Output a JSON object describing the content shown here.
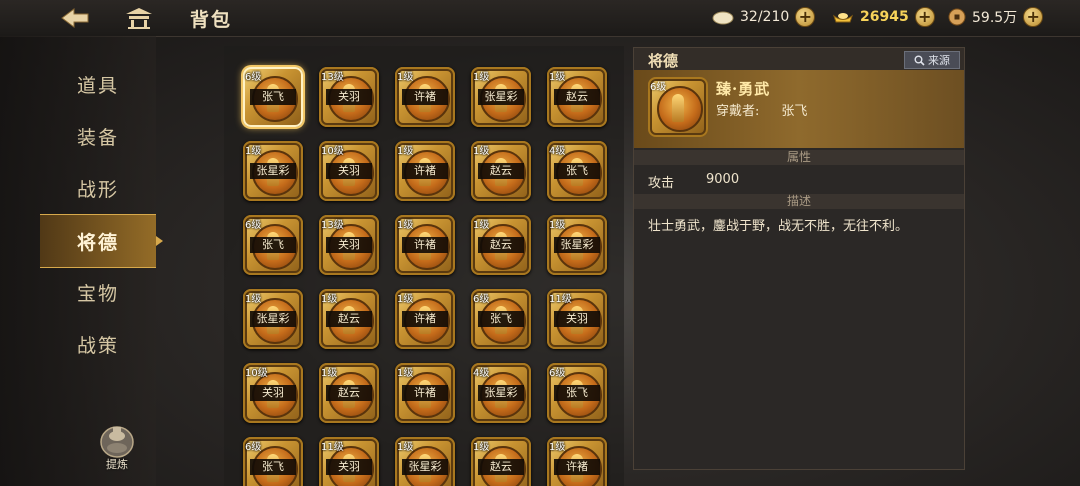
{
  "header": {
    "title": "背包",
    "back_icon": "back-arrow-icon",
    "home_icon": "pavilion-icon"
  },
  "resources": [
    {
      "icon": "rice-icon",
      "value": "32/210"
    },
    {
      "icon": "gold-ingot-icon",
      "value": "26945"
    },
    {
      "icon": "copper-coin-icon",
      "value": "59.5万"
    }
  ],
  "sidebar": {
    "items": [
      {
        "label": "道具",
        "active": false
      },
      {
        "label": "装备",
        "active": false
      },
      {
        "label": "战形",
        "active": false
      },
      {
        "label": "将德",
        "active": true
      },
      {
        "label": "宝物",
        "active": false
      },
      {
        "label": "战策",
        "active": false
      }
    ],
    "refine_label": "提炼"
  },
  "grid": {
    "items": [
      {
        "level": "6级",
        "name": "张飞",
        "selected": true
      },
      {
        "level": "13级",
        "name": "关羽"
      },
      {
        "level": "1级",
        "name": "许褚"
      },
      {
        "level": "1级",
        "name": "张星彩"
      },
      {
        "level": "1级",
        "name": "赵云"
      },
      {
        "level": "1级",
        "name": "张星彩"
      },
      {
        "level": "10级",
        "name": "关羽"
      },
      {
        "level": "1级",
        "name": "许褚"
      },
      {
        "level": "1级",
        "name": "赵云"
      },
      {
        "level": "4级",
        "name": "张飞"
      },
      {
        "level": "6级",
        "name": "张飞"
      },
      {
        "level": "13级",
        "name": "关羽"
      },
      {
        "level": "1级",
        "name": "许褚"
      },
      {
        "level": "1级",
        "name": "赵云"
      },
      {
        "level": "1级",
        "name": "张星彩"
      },
      {
        "level": "1级",
        "name": "张星彩"
      },
      {
        "level": "1级",
        "name": "赵云"
      },
      {
        "level": "1级",
        "name": "许褚"
      },
      {
        "level": "6级",
        "name": "张飞"
      },
      {
        "level": "11级",
        "name": "关羽"
      },
      {
        "level": "10级",
        "name": "关羽"
      },
      {
        "level": "1级",
        "name": "赵云"
      },
      {
        "level": "1级",
        "name": "许褚"
      },
      {
        "level": "4级",
        "name": "张星彩"
      },
      {
        "level": "6级",
        "name": "张飞"
      },
      {
        "level": "6级",
        "name": "张飞"
      },
      {
        "level": "11级",
        "name": "关羽"
      },
      {
        "level": "1级",
        "name": "张星彩"
      },
      {
        "level": "1级",
        "name": "赵云"
      },
      {
        "level": "1级",
        "name": "许褚"
      }
    ]
  },
  "detail": {
    "title": "将德",
    "source_label": "来源",
    "source_icon": "magnifier-icon",
    "item_level": "6级",
    "item_name": "臻·勇武",
    "wearer_label": "穿戴者:",
    "wearer_name": "张飞",
    "attr_section": "属性",
    "attr_name": "攻击",
    "attr_value": "9000",
    "desc_section": "描述",
    "description": "壮士勇武，鏖战于野，战无不胜，无往不利。"
  },
  "colors": {
    "accent_gold": "#d7a94c",
    "gold_text": "#f7d35a",
    "panel_bg": "#2b2826"
  }
}
